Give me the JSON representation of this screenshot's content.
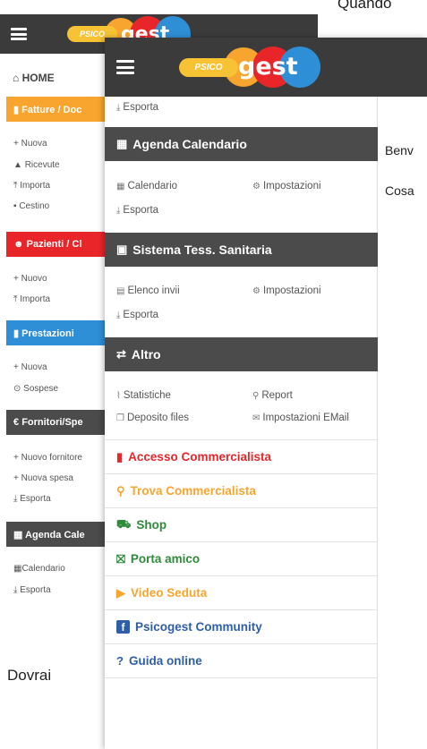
{
  "doc": {
    "top_text": "Quando",
    "bottom_text": "Dovrai",
    "right_line1": "Benv",
    "right_line2": "Cosa"
  },
  "logo": {
    "psico": "PSICO",
    "gest": "gest"
  },
  "back_menu": {
    "home": "HOME",
    "sections": [
      {
        "label": "Fatture / Doc",
        "color": "#f7a52e",
        "items": [
          "Nuova",
          "Ricevute",
          "Importa",
          "Cestino"
        ]
      },
      {
        "label": "Pazienti / Cl",
        "color": "#e8262a",
        "items": [
          "Nuovo",
          "Importa"
        ]
      },
      {
        "label": "Prestazioni",
        "color": "#2e8fd6",
        "items": [
          "Nuova",
          "Sospese"
        ]
      },
      {
        "label": "Fornitori/Spe",
        "color": "#4b4b4b",
        "items": [
          "Nuovo fornitore",
          "Nuova spesa",
          "Esporta"
        ]
      },
      {
        "label": "Agenda Cale",
        "color": "#4b4b4b",
        "items": [
          "Calendario",
          "Esporta"
        ]
      }
    ]
  },
  "front_menu": {
    "top_item": "Esporta",
    "agenda": {
      "title": "Agenda Calendario",
      "items": [
        "Calendario",
        "Impostazioni",
        "Esporta"
      ]
    },
    "sistema": {
      "title": "Sistema Tess. Sanitaria",
      "items": [
        "Elenco invii",
        "Impostazioni",
        "Esporta"
      ]
    },
    "altro": {
      "title": "Altro",
      "items": [
        "Statistiche",
        "Report",
        "Deposito files",
        "Impostazioni EMail"
      ]
    },
    "links": [
      {
        "label": "Accesso Commercialista",
        "color": "#e8262a",
        "icon": "briefcase-icon"
      },
      {
        "label": "Trova Commercialista",
        "color": "#f7a52e",
        "icon": "search-icon"
      },
      {
        "label": "Shop",
        "color": "#2e8b3a",
        "icon": "cart-icon"
      },
      {
        "label": "Porta amico",
        "color": "#2e8b3a",
        "icon": "gift-icon"
      },
      {
        "label": "Video Seduta",
        "color": "#f7a52e",
        "icon": "video-icon"
      },
      {
        "label": "Psicogest Community",
        "color": "#2f5ea8",
        "icon": "facebook-icon"
      },
      {
        "label": "Guida online",
        "color": "#2f5ea8",
        "icon": "help-icon"
      }
    ]
  }
}
